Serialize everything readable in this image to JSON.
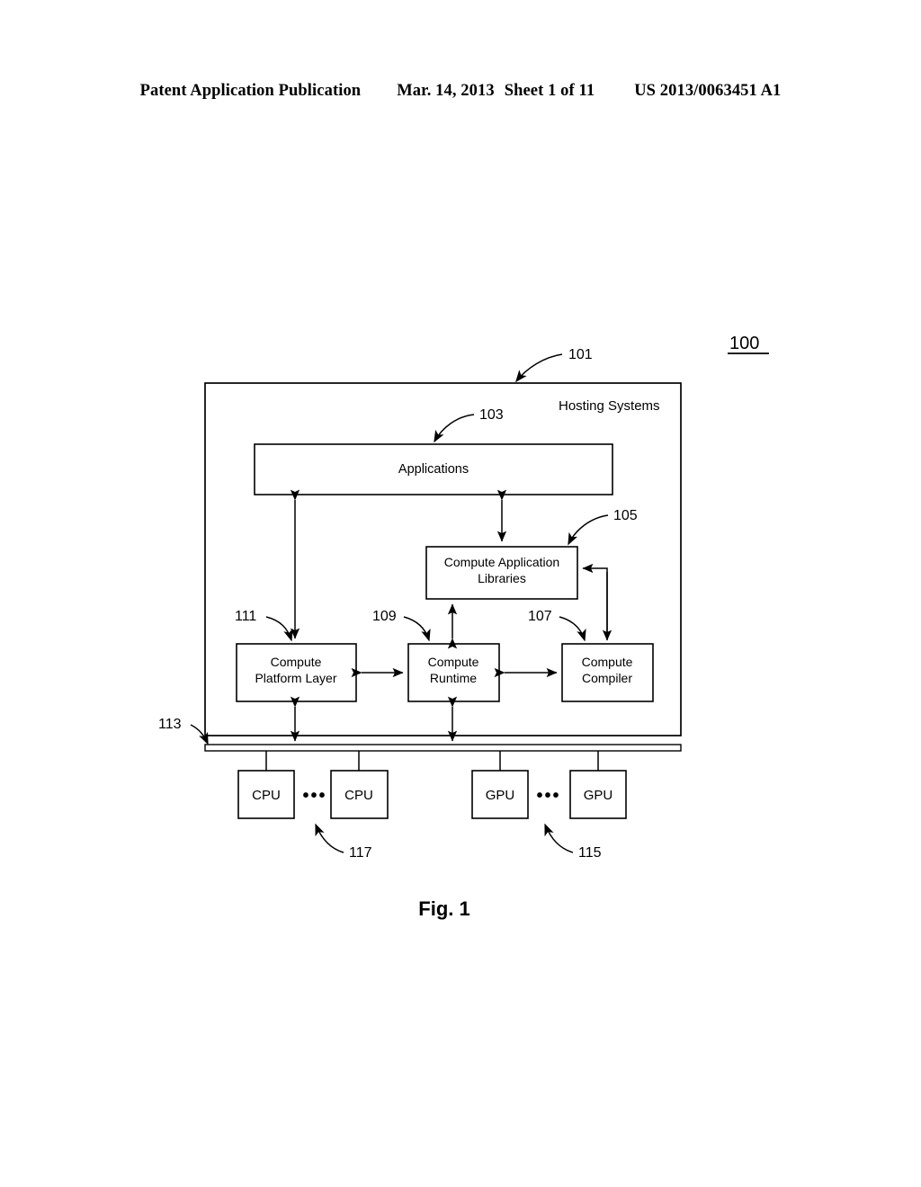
{
  "header": {
    "publication": "Patent Application Publication",
    "date": "Mar. 14, 2013",
    "sheet": "Sheet 1 of 11",
    "patent_number": "US 2013/0063451 A1"
  },
  "figure": {
    "caption": "Fig. 1",
    "figure_number": "100",
    "system_label": "Hosting Systems",
    "boxes": {
      "applications": "Applications",
      "compute_application_libraries_line1": "Compute Application",
      "compute_application_libraries_line2": "Libraries",
      "compute_platform_layer_line1": "Compute",
      "compute_platform_layer_line2": "Platform Layer",
      "compute_runtime_line1": "Compute",
      "compute_runtime_line2": "Runtime",
      "compute_compiler_line1": "Compute",
      "compute_compiler_line2": "Compiler",
      "cpu_1": "CPU",
      "cpu_2": "CPU",
      "gpu_1": "GPU",
      "gpu_2": "GPU",
      "ellipsis_cpu": "•••",
      "ellipsis_gpu": "•••"
    },
    "reference_numerals": {
      "hosting_systems": "101",
      "applications": "103",
      "compute_application_libraries": "105",
      "compute_compiler": "107",
      "compute_runtime": "109",
      "compute_platform_layer": "111",
      "bus": "113",
      "gpu_group": "115",
      "cpu_group": "117"
    }
  },
  "colors": {
    "ink": "#000000",
    "paper": "#ffffff"
  }
}
